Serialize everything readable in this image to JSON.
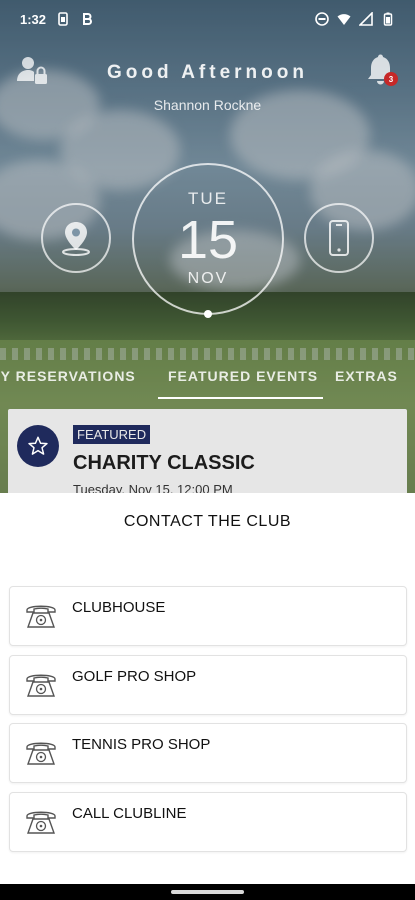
{
  "status_bar": {
    "time": "1:32",
    "icons": [
      "sim-icon",
      "b-app-icon",
      "do-not-disturb-icon",
      "wifi-icon",
      "signal-icon",
      "battery-icon"
    ]
  },
  "header": {
    "greeting": "Good Afternoon",
    "user_name": "Shannon Rockne",
    "notification_count": "3"
  },
  "date_widget": {
    "day": "TUE",
    "date": "15",
    "month": "NOV"
  },
  "tabs": [
    {
      "label": "MY RESERVATIONS"
    },
    {
      "label": "FEATURED EVENTS",
      "active": true
    },
    {
      "label": "EXTRAS"
    }
  ],
  "featured_event": {
    "tag": "FEATURED",
    "title": "CHARITY CLASSIC",
    "datetime": "Tuesday, Nov 15, 12:00 PM"
  },
  "contact_sheet": {
    "title": "CONTACT THE CLUB",
    "items": [
      {
        "label": "CLUBHOUSE"
      },
      {
        "label": "GOLF PRO SHOP"
      },
      {
        "label": "TENNIS PRO SHOP"
      },
      {
        "label": "CALL CLUBLINE"
      }
    ]
  },
  "colors": {
    "accent_navy": "#1f2a5c",
    "badge_red": "#c62828"
  }
}
